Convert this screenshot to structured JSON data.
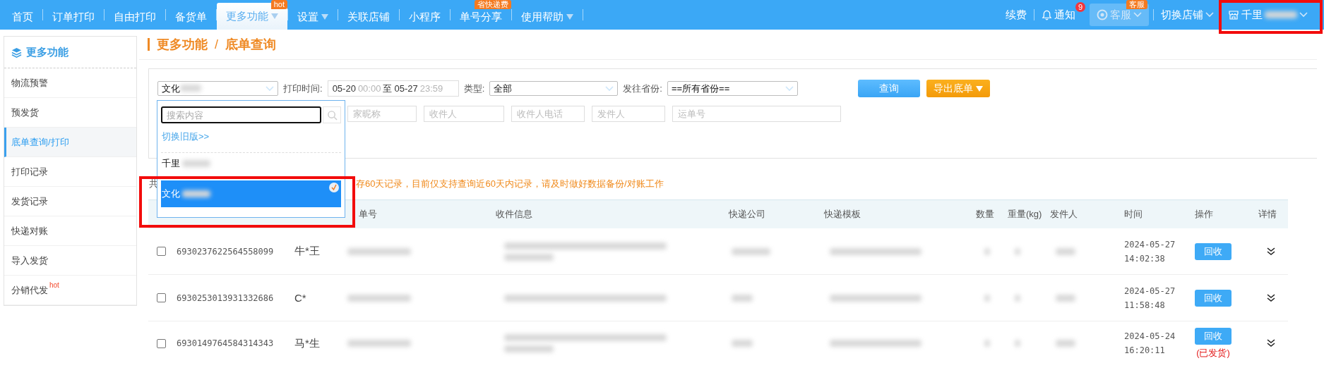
{
  "top_nav": {
    "items": [
      {
        "label": "首页",
        "selected": false,
        "dropdown": false
      },
      {
        "label": "订单打印",
        "selected": false,
        "dropdown": false
      },
      {
        "label": "自由打印",
        "selected": false,
        "dropdown": false
      },
      {
        "label": "备货单",
        "selected": false,
        "dropdown": false
      },
      {
        "label": "更多功能",
        "selected": true,
        "dropdown": true,
        "badge": "hot"
      },
      {
        "label": "设置",
        "selected": false,
        "dropdown": true
      },
      {
        "label": "关联店铺",
        "selected": false,
        "dropdown": false
      },
      {
        "label": "小程序",
        "selected": false,
        "dropdown": false
      },
      {
        "label": "单号分享",
        "selected": false,
        "dropdown": false,
        "badge": "省快递费"
      },
      {
        "label": "使用帮助",
        "selected": false,
        "dropdown": true
      }
    ],
    "renew": "续费",
    "notify": {
      "label": "通知",
      "count": "9"
    },
    "service": {
      "label": "客服",
      "badge": "客服",
      "disabled": true
    },
    "switch_store": "切换店铺",
    "store": {
      "name": "千里",
      "highlighted": true
    }
  },
  "sidebar": {
    "title": "更多功能",
    "items": [
      {
        "label": "物流预警",
        "selected": false
      },
      {
        "label": "预发货",
        "selected": false
      },
      {
        "label": "底单查询/打印",
        "selected": true
      },
      {
        "label": "打印记录",
        "selected": false
      },
      {
        "label": "发货记录",
        "selected": false
      },
      {
        "label": "快递对账",
        "selected": false
      },
      {
        "label": "导入发货",
        "selected": false
      },
      {
        "label": "分销代发",
        "selected": false,
        "badge": "hot"
      }
    ]
  },
  "breadcrumb": {
    "items": [
      "更多功能",
      "底单查询"
    ],
    "separator": "/"
  },
  "filters": {
    "shop_select": "文化",
    "print_time_label": "打印时间:",
    "print_time": {
      "start_date": "05-20",
      "start_time": "00:00",
      "separator": "至",
      "end_date": "05-27",
      "end_time": "23:59"
    },
    "type_label": "类型:",
    "type_value": "全部",
    "province_label": "发往省份:",
    "province_value": "==所有省份==",
    "query_button": "查询",
    "export_button": "导出底单",
    "fields": [
      {
        "placeholder": "家昵称"
      },
      {
        "placeholder": "收件人"
      },
      {
        "placeholder": "收件人电话"
      },
      {
        "placeholder": "发件人"
      },
      {
        "placeholder": "运单号"
      }
    ]
  },
  "shop_dropdown": {
    "search_placeholder": "搜索内容",
    "old_version_link": "切换旧版>>",
    "options": [
      {
        "label": "千里",
        "selected": false,
        "highlighted": false
      },
      {
        "label": "文化",
        "selected": true,
        "highlighted": true
      }
    ]
  },
  "notice": {
    "lead": "共",
    "text": "存60天记录，目前仅支持查询近60天内记录，请及时做好数据备份/对账工作"
  },
  "table": {
    "columns": [
      "单号",
      "收件信息",
      "快递公司",
      "快递模板",
      "数量",
      "重量(kg)",
      "发件人",
      "时间",
      "操作",
      "详情"
    ],
    "rows": [
      {
        "checked": false,
        "order_no": "6930237622564558099",
        "receiver": "牛*王",
        "date": "2024-05-27",
        "clock": "14:02:38",
        "action": "回收"
      },
      {
        "checked": false,
        "order_no": "6930253013931332686",
        "receiver": "C*",
        "date": "2024-05-27",
        "clock": "11:58:48",
        "action": "回收"
      },
      {
        "checked": false,
        "order_no": "6930149764584314343",
        "receiver": "马*生",
        "date": "2024-05-24",
        "clock": "16:20:11",
        "action": "回收",
        "status": "(已发货)"
      }
    ]
  }
}
